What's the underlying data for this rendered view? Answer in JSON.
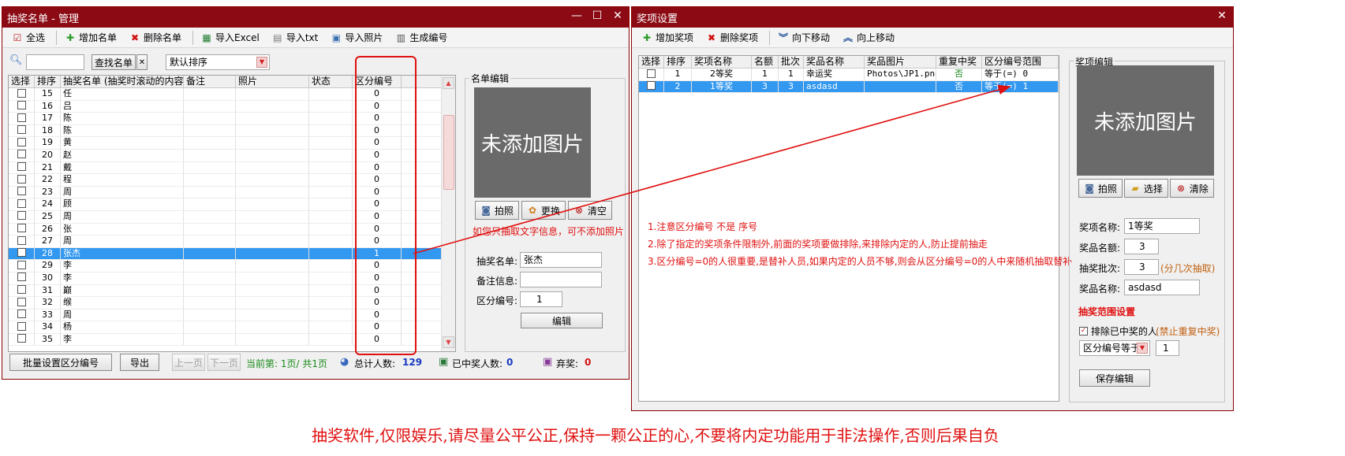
{
  "left_window": {
    "title": "抽奖名单 - 管理",
    "toolbar": {
      "select_all": "全选",
      "add": "增加名单",
      "delete": "删除名单",
      "import_excel": "导入Excel",
      "import_txt": "导入txt",
      "import_photo": "导入照片",
      "gen_id": "生成编号"
    },
    "search_button": "查找名单",
    "clear_button": "✕",
    "sort_select": "默认排序",
    "columns": [
      "选择",
      "排序",
      "抽奖名单 (抽奖时滚动的内容)",
      "备注",
      "照片",
      "状态",
      "区分编号"
    ],
    "rows": [
      {
        "order": "15",
        "name": "任",
        "code": "0"
      },
      {
        "order": "16",
        "name": "吕",
        "code": "0"
      },
      {
        "order": "17",
        "name": "陈",
        "code": "0"
      },
      {
        "order": "18",
        "name": "陈",
        "code": "0"
      },
      {
        "order": "19",
        "name": "黄",
        "code": "0"
      },
      {
        "order": "20",
        "name": "赵",
        "code": "0"
      },
      {
        "order": "21",
        "name": "戴",
        "code": "0"
      },
      {
        "order": "22",
        "name": "程",
        "code": "0"
      },
      {
        "order": "23",
        "name": "周",
        "code": "0"
      },
      {
        "order": "24",
        "name": "顾",
        "code": "0"
      },
      {
        "order": "25",
        "name": "周",
        "code": "0"
      },
      {
        "order": "26",
        "name": "张",
        "code": "0"
      },
      {
        "order": "27",
        "name": "周",
        "code": "0"
      },
      {
        "order": "28",
        "name": "张杰",
        "code": "1"
      },
      {
        "order": "29",
        "name": "李",
        "code": "0"
      },
      {
        "order": "30",
        "name": "李",
        "code": "0"
      },
      {
        "order": "31",
        "name": "巅",
        "code": "0"
      },
      {
        "order": "32",
        "name": "缑",
        "code": "0"
      },
      {
        "order": "33",
        "name": "周",
        "code": "0"
      },
      {
        "order": "34",
        "name": "杨",
        "code": "0"
      },
      {
        "order": "35",
        "name": "李",
        "code": "0"
      }
    ],
    "edit_group": {
      "title": "名单编辑",
      "no_photo": "未添加图片",
      "btn_photo": "拍照",
      "btn_change": "更换",
      "btn_clear": "清空",
      "hint": "如您只抽取文字信息，可不添加照片",
      "name_label": "抽奖名单:",
      "name_value": "张杰",
      "note_label": "备注信息:",
      "note_value": "",
      "code_label": "区分编号:",
      "code_value": "1",
      "edit_button": "编辑"
    },
    "footer": {
      "batch_button": "批量设置区分编号",
      "export_button": "导出",
      "prev_page": "上一页",
      "next_page": "下一页",
      "page_info": "当前第: 1页/ 共1页",
      "total_label": "总计人数:",
      "total_value": "129",
      "won_label": "已中奖人数:",
      "won_value": "0",
      "abandon_label": "弃奖:",
      "abandon_value": "0"
    }
  },
  "right_window": {
    "title": "奖项设置",
    "toolbar": {
      "add": "增加奖项",
      "delete": "删除奖项",
      "move_down": "向下移动",
      "move_up": "向上移动"
    },
    "columns": [
      "选择",
      "排序",
      "奖项名称",
      "名额",
      "批次",
      "奖品名称",
      "奖品图片",
      "重复中奖",
      "区分编号范围"
    ],
    "rows": [
      {
        "order": "1",
        "name": "2等奖",
        "quota": "1",
        "batch": "1",
        "prize": "幸运奖",
        "image": "Photos\\JP1.png",
        "repeat": "否",
        "range": "等于(=) 0"
      },
      {
        "order": "2",
        "name": "1等奖",
        "quota": "3",
        "batch": "3",
        "prize": "asdasd",
        "image": "",
        "repeat": "否",
        "range": "等于(=) 1"
      }
    ],
    "notes": [
      "1.注意区分编号 不是 序号",
      "2.除了指定的奖项条件限制外,前面的奖项要做排除,来排除内定的人,防止提前抽走",
      "3.区分编号=0的人很重要,是替补人员,如果内定的人员不够,则会从区分编号=0的人中来随机抽取替补"
    ],
    "edit_group": {
      "title": "奖项编辑",
      "no_photo": "未添加图片",
      "btn_photo": "拍照",
      "btn_select": "选择",
      "btn_clear": "清除",
      "name_label": "奖项名称:",
      "name_value": "1等奖",
      "quota_label": "奖品名额:",
      "quota_value": "3",
      "batch_label": "抽奖批次:",
      "batch_value": "3",
      "batch_hint": "(分几次抽取)",
      "prize_label": "奖品名称:",
      "prize_value": "asdasd",
      "range_title": "抽奖范围设置",
      "exclude_label": "排除已中奖的人",
      "exclude_hint": "(禁止重复中奖)",
      "range_select": "区分编号等于",
      "range_value": "1",
      "save_button": "保存编辑"
    }
  },
  "bottom_banner": "抽奖软件,仅限娱乐,请尽量公平公正,保持一颗公正的心,不要将内定功能用于非法操作,否则后果自负",
  "colors": {
    "title_bar": "#8b0a14",
    "annotation": "#e01010",
    "selection": "#3398f0"
  }
}
